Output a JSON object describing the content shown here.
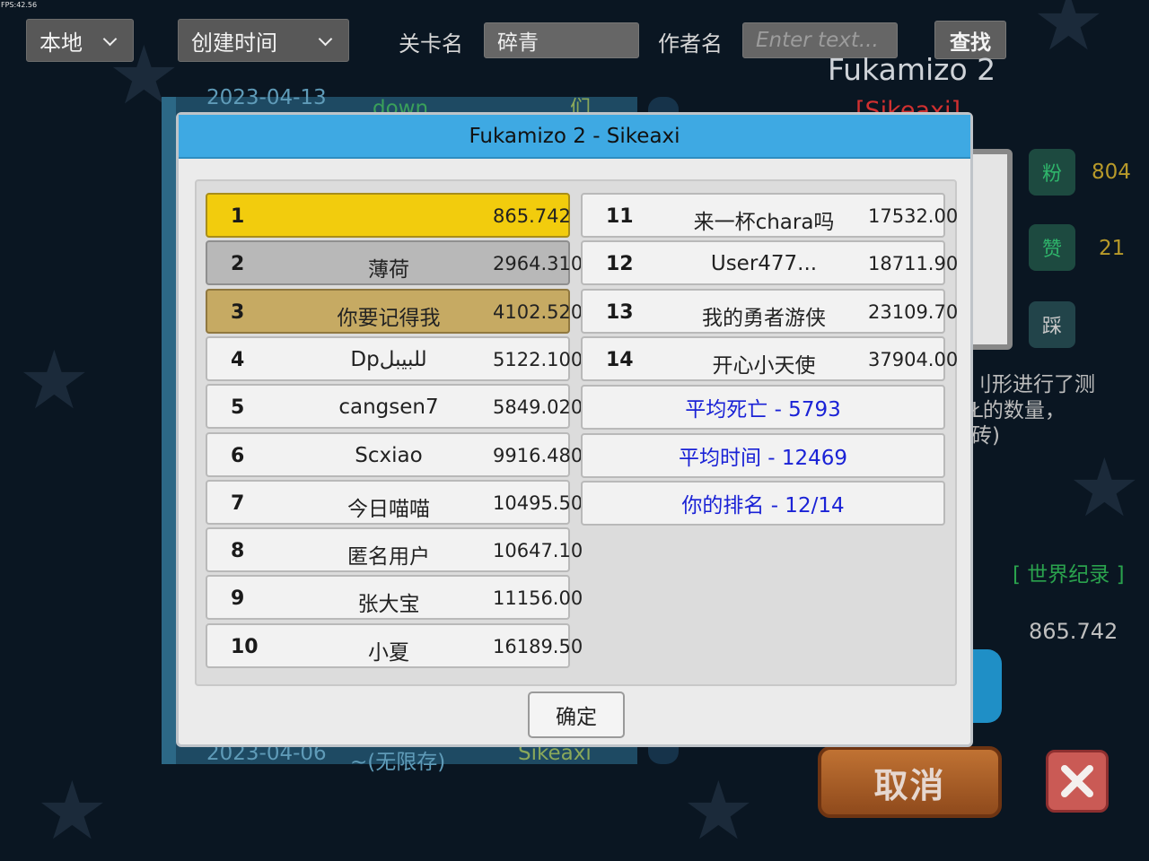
{
  "fps": "FPS:42.56",
  "toolbar": {
    "source_select": "本地",
    "sort_select": "创建时间",
    "level_name_label": "关卡名",
    "level_name_value": "碎青",
    "author_label": "作者名",
    "author_placeholder": "Enter text...",
    "find_label": "查找"
  },
  "background_list": {
    "top_date": "2023-04-13",
    "top_name": "down",
    "top_author": "们",
    "bottom_date": "2023-04-06",
    "bottom_name": "~(无限存)",
    "bottom_author": "Sikeaxi"
  },
  "detail": {
    "title": "Fukamizo 2",
    "author": "[Sikeaxi]",
    "fans_icon": "粉",
    "fans_count": "804",
    "likes_icon": "赞",
    "likes_count": "21",
    "dislike_icon": "踩",
    "description_lines": [
      "刂形进行了测",
      "Ł的数量，",
      "砖)"
    ],
    "world_record_label": "[ 世界纪录 ]",
    "world_record_value": "865.742",
    "cancel_label": "取消"
  },
  "modal": {
    "title": "Fukamizo 2 - Sikeaxi",
    "ok_label": "确定",
    "rankings": [
      {
        "rank": "1",
        "name": "",
        "score": "865.742",
        "medal": "gold"
      },
      {
        "rank": "2",
        "name": "薄荷",
        "score": "2964.310",
        "medal": "silver"
      },
      {
        "rank": "3",
        "name": "你要记得我",
        "score": "4102.520",
        "medal": "bronze"
      },
      {
        "rank": "4",
        "name": "Dpللبيبل",
        "score": "5122.100",
        "medal": "none"
      },
      {
        "rank": "5",
        "name": "cangsen7",
        "score": "5849.020",
        "medal": "none"
      },
      {
        "rank": "6",
        "name": "Scxiao",
        "score": "9916.480",
        "medal": "none"
      },
      {
        "rank": "7",
        "name": "今日喵喵",
        "score": "10495.50",
        "medal": "none"
      },
      {
        "rank": "8",
        "name": "匿名用户",
        "score": "10647.10",
        "medal": "none"
      },
      {
        "rank": "9",
        "name": "张大宝",
        "score": "11156.00",
        "medal": "none"
      },
      {
        "rank": "10",
        "name": "小夏",
        "score": "16189.50",
        "medal": "none"
      },
      {
        "rank": "11",
        "name": "来一杯chara吗",
        "score": "17532.00",
        "medal": "none"
      },
      {
        "rank": "12",
        "name": "User477...",
        "score": "18711.90",
        "medal": "none"
      },
      {
        "rank": "13",
        "name": "我的勇者游侠",
        "score": "23109.70",
        "medal": "none"
      },
      {
        "rank": "14",
        "name": "开心小天使",
        "score": "37904.00",
        "medal": "none"
      }
    ],
    "summary": {
      "avg_deaths": "平均死亡 - 5793",
      "avg_time": "平均时间 - 12469",
      "your_rank": "你的排名 - 12/14"
    }
  }
}
